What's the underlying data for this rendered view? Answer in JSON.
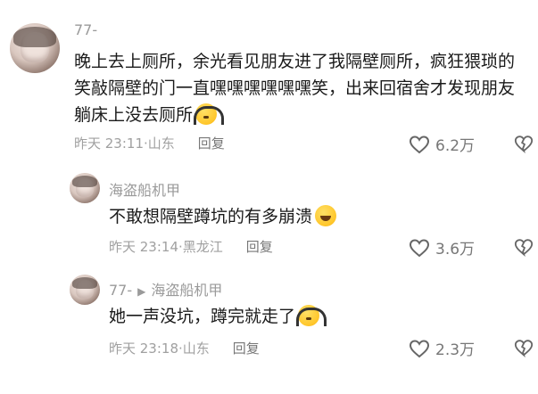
{
  "comments": [
    {
      "username": "77-",
      "text": "晚上去上厕所，余光看见朋友进了我隔壁厕所，疯狂猥琐的笑敲隔壁的门一直嘿嘿嘿嘿嘿嘿笑，出来回宿舍才发现朋友躺床上没去厕所",
      "emoji": "headphones-face-emoji",
      "time": "昨天 23:11",
      "location": "山东",
      "reply_label": "回复",
      "likes": "6.2万"
    },
    {
      "username": "海盗船机甲",
      "text": "不敢想隔壁蹲坑的有多崩溃",
      "emoji": "laughing-face-emoji",
      "time": "昨天 23:14",
      "location": "黑龙江",
      "reply_label": "回复",
      "likes": "3.6万"
    },
    {
      "username": "77-",
      "reply_to": "海盗船机甲",
      "text": "她一声没坑，蹲完就走了",
      "emoji": "headphones-face-emoji",
      "time": "昨天 23:18",
      "location": "山东",
      "reply_label": "回复",
      "likes": "2.3万"
    }
  ],
  "separator": "·",
  "colors": {
    "text": "#1a1a1a",
    "secondary": "#a0a0a0",
    "icon": "#777777"
  }
}
